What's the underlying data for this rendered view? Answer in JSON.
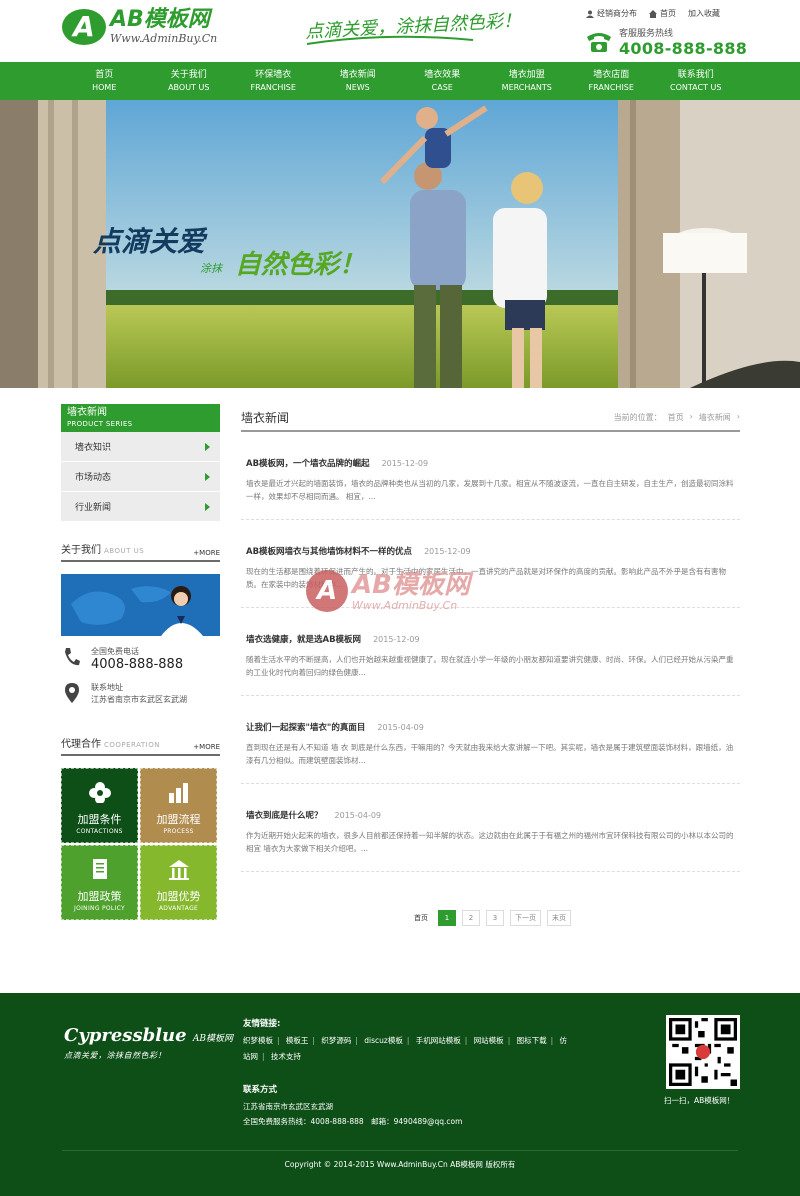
{
  "header": {
    "logo_mark": "A",
    "logo_title": "AB模板网",
    "logo_sub": "Www.AdminBuy.Cn",
    "slogan": "点滴关爱，涂抹自然色彩！",
    "top_links": [
      "经销商分布",
      "首页",
      "加入收藏"
    ],
    "hotline_label": "客服服务热线",
    "hotline_number": "4008-888-888"
  },
  "nav": [
    {
      "cn": "首页",
      "en": "HOME"
    },
    {
      "cn": "关于我们",
      "en": "ABOUT US"
    },
    {
      "cn": "环保墙衣",
      "en": "FRANCHISE"
    },
    {
      "cn": "墙衣新闻",
      "en": "NEWS"
    },
    {
      "cn": "墙衣效果",
      "en": "CASE"
    },
    {
      "cn": "墙衣加盟",
      "en": "MERCHANTS"
    },
    {
      "cn": "墙衣店面",
      "en": "FRANCHISE"
    },
    {
      "cn": "联系我们",
      "en": "CONTACT US"
    }
  ],
  "banner": {
    "line1": "点滴关爱",
    "line2": "涂抹",
    "line3": "自然色彩！"
  },
  "sidebar": {
    "category_title": "墙衣新闻",
    "category_en": "PRODUCT SERIES",
    "categories": [
      "墙衣知识",
      "市场动态",
      "行业新闻"
    ],
    "about_title": "关于我们",
    "about_en": "ABOUT US",
    "more": "+MORE",
    "phone_label": "全国免费电话",
    "phone": "4008-888-888",
    "address_label": "联系地址",
    "address": "江苏省南京市玄武区玄武湖",
    "coop_title": "代理合作",
    "coop_en": "COOPERATION",
    "tiles": [
      {
        "cn": "加盟条件",
        "en": "CONTACTIONS",
        "color": "#0e4f18"
      },
      {
        "cn": "加盟流程",
        "en": "PROCESS",
        "color": "#b08d4f"
      },
      {
        "cn": "加盟政策",
        "en": "JOINING POLICY",
        "color": "#4ea12c"
      },
      {
        "cn": "加盟优势",
        "en": "ADVANTAGE",
        "color": "#86b82e"
      }
    ]
  },
  "main": {
    "title": "墙衣新闻",
    "crumb": [
      "当前的位置：",
      "首页",
      "墙衣新闻"
    ],
    "news": [
      {
        "title": "AB模板网，一个墙衣品牌的崛起",
        "date": "2015-12-09",
        "summary": "墙衣是最近才兴起的墙面装饰，墙衣的品牌种类也从当初的几家，发展到十几家。相宜从不随波逐流，一直在自主研发，自主生产，创造最初同涂料一样，效果却不尽相同而遇。 相宜，..."
      },
      {
        "title": "AB模板网墙衣与其他墙饰材料不一样的优点",
        "date": "2015-12-09",
        "summary": "现在的生活都是围绕着环保进而产生的。对于生活中的家居生活中，一直讲究的产品就是对环保作的高度的贡献。影响此产品不外乎是含有有害物质。在家装中的装饰材料中..."
      },
      {
        "title": "墙衣选健康，就是选AB模板网",
        "date": "2015-12-09",
        "summary": "随着生活水平的不断提高，人们也开始越来越重视健康了。现在就连小学一年级的小朋友都知道要讲究健康、时尚、环保。人们已经开始从污染严重的工业化时代向着回归的绿色健康..."
      },
      {
        "title": "让我们一起探索\"墙衣\"的真面目",
        "date": "2015-04-09",
        "summary": "直到现在还是有人不知道 墙 衣 到底是什么东西，干嘛用的？今天就由我来给大家讲解一下吧。其实呢，墙衣是属于建筑壁面装饰材料，跟墙纸，油漆有几分相似。而建筑壁面装饰材..."
      },
      {
        "title": "墙衣到底是什么呢？",
        "date": "2015-04-09",
        "summary": "作为近期开始火起来的墙衣，很多人目前都还保持着一知半解的状态。这边就由在此属于于有福之州的福州市宜环保科技有限公司的小林以本公司的 相宜 墙衣为大家做下相关介绍吧。..."
      }
    ],
    "pager": [
      "首页",
      "1",
      "2",
      "3",
      "下一页",
      "末页"
    ]
  },
  "watermark": {
    "mark": "A",
    "title": "AB模板网",
    "sub": "Www.AdminBuy.Cn"
  },
  "footer": {
    "brand": "Cypressblue",
    "brand_small": "AB模板网",
    "tagline": "点滴关爱，涂抹自然色彩！",
    "links_title": "友情链接:",
    "links": [
      "织梦模板",
      "模板王",
      "织梦源码",
      "discuz模板",
      "手机网站模板",
      "网站模板",
      "图标下载",
      "仿站网",
      "技术支持"
    ],
    "contact_title": "联系方式",
    "address": "江苏省南京市玄武区玄武湖",
    "hotline": "全国免费服务热线：4008-888-888　邮箱：9490489@qq.com",
    "qr_caption": "扫一扫，AB模板网！",
    "copyright": "Copyright © 2014-2015 Www.AdminBuy.Cn AB模板网 版权所有"
  }
}
